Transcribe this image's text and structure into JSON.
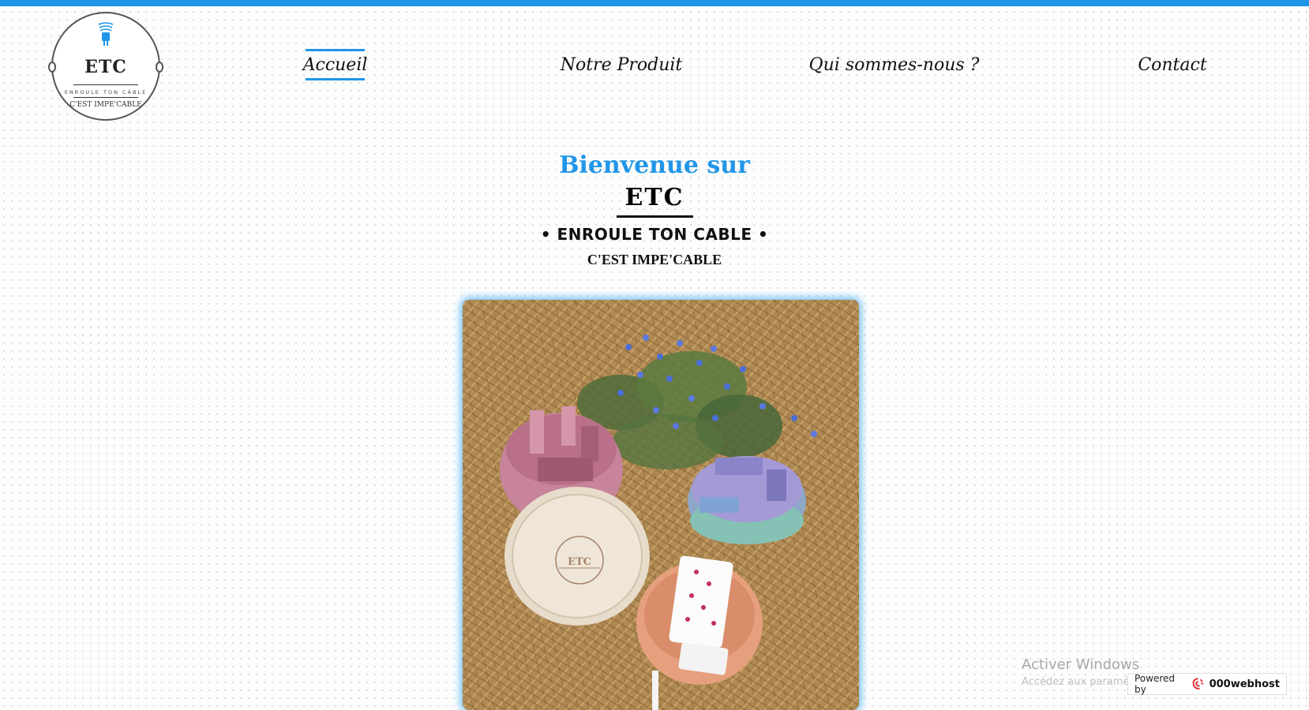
{
  "logo": {
    "brand": "ETC",
    "subtitle": "ENROULE TON CÂBLE",
    "tagline": "C'EST IMPE'CABLE",
    "accent_color": "#2196e8",
    "icon": "plug-icon"
  },
  "nav": {
    "items": [
      {
        "label": "Accueil",
        "active": true
      },
      {
        "label": "Notre Produit",
        "active": false
      },
      {
        "label": "Qui sommes-nous ?",
        "active": false
      },
      {
        "label": "Contact",
        "active": false
      }
    ]
  },
  "hero": {
    "welcome": "Bienvenue sur",
    "title": "ETC",
    "slogan": "• ENROULE TON CABLE •",
    "tagline": "C'EST IMPE'CABLE",
    "welcome_color": "#2196e8"
  },
  "photo": {
    "box_label": "ETC"
  },
  "overlay": {
    "activate_title": "Activer Windows",
    "activate_sub": "Accédez aux paramètres pour activer Windows.",
    "powered_by": "Powered by",
    "host_name": "000webhost",
    "host_icon": "webhost-logo-icon"
  }
}
